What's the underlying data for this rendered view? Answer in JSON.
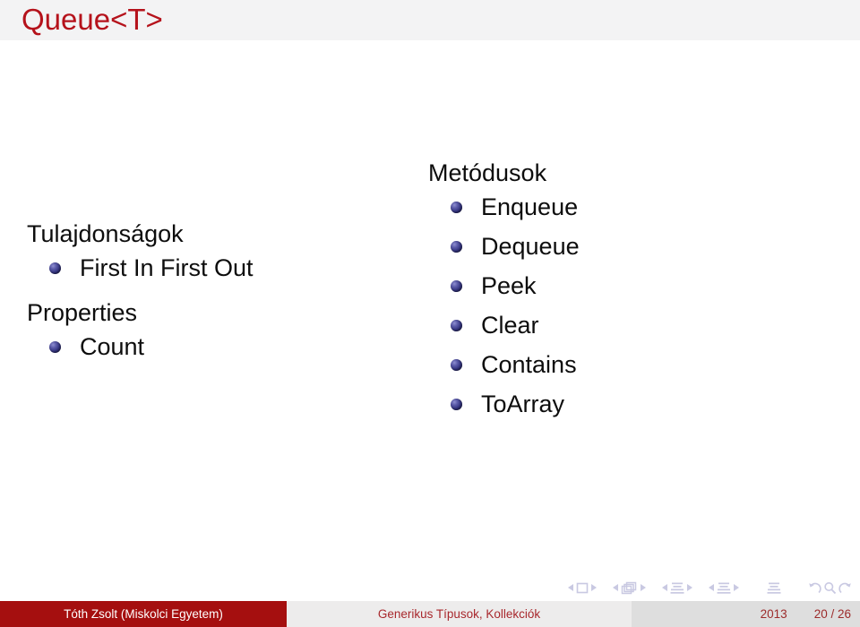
{
  "slide": {
    "title": "Queue<T>",
    "title_color": "#b5121b"
  },
  "left_column": {
    "blocks": [
      {
        "heading": "Tulajdonságok",
        "items": [
          "First In First Out"
        ]
      },
      {
        "heading": "Properties",
        "items": [
          "Count"
        ]
      }
    ]
  },
  "right_column": {
    "blocks": [
      {
        "heading": "Metódusok",
        "items": [
          "Enqueue",
          "Dequeue",
          "Peek",
          "Clear",
          "Contains",
          "ToArray"
        ]
      }
    ]
  },
  "navigation": {
    "icons": [
      "left-triangle-icon",
      "slide-square-icon",
      "right-triangle-icon",
      "left-triangle-icon",
      "frames-stack-icon",
      "right-triangle-icon",
      "left-triangle-icon",
      "subsection-lines-icon",
      "right-triangle-icon",
      "left-triangle-icon",
      "section-lines-icon",
      "right-triangle-icon",
      "document-lines-icon",
      "back-arrow-icon",
      "search-icon",
      "forward-arrow-icon"
    ]
  },
  "footer": {
    "author": "Tóth Zsolt  (Miskolci Egyetem)",
    "presentation_title": "Generikus Típusok, Kollekciók",
    "year": "2013",
    "page": "20 / 26",
    "author_bg": "#a50f0f",
    "title_bg": "#edecec",
    "meta_bg": "#dedede"
  }
}
